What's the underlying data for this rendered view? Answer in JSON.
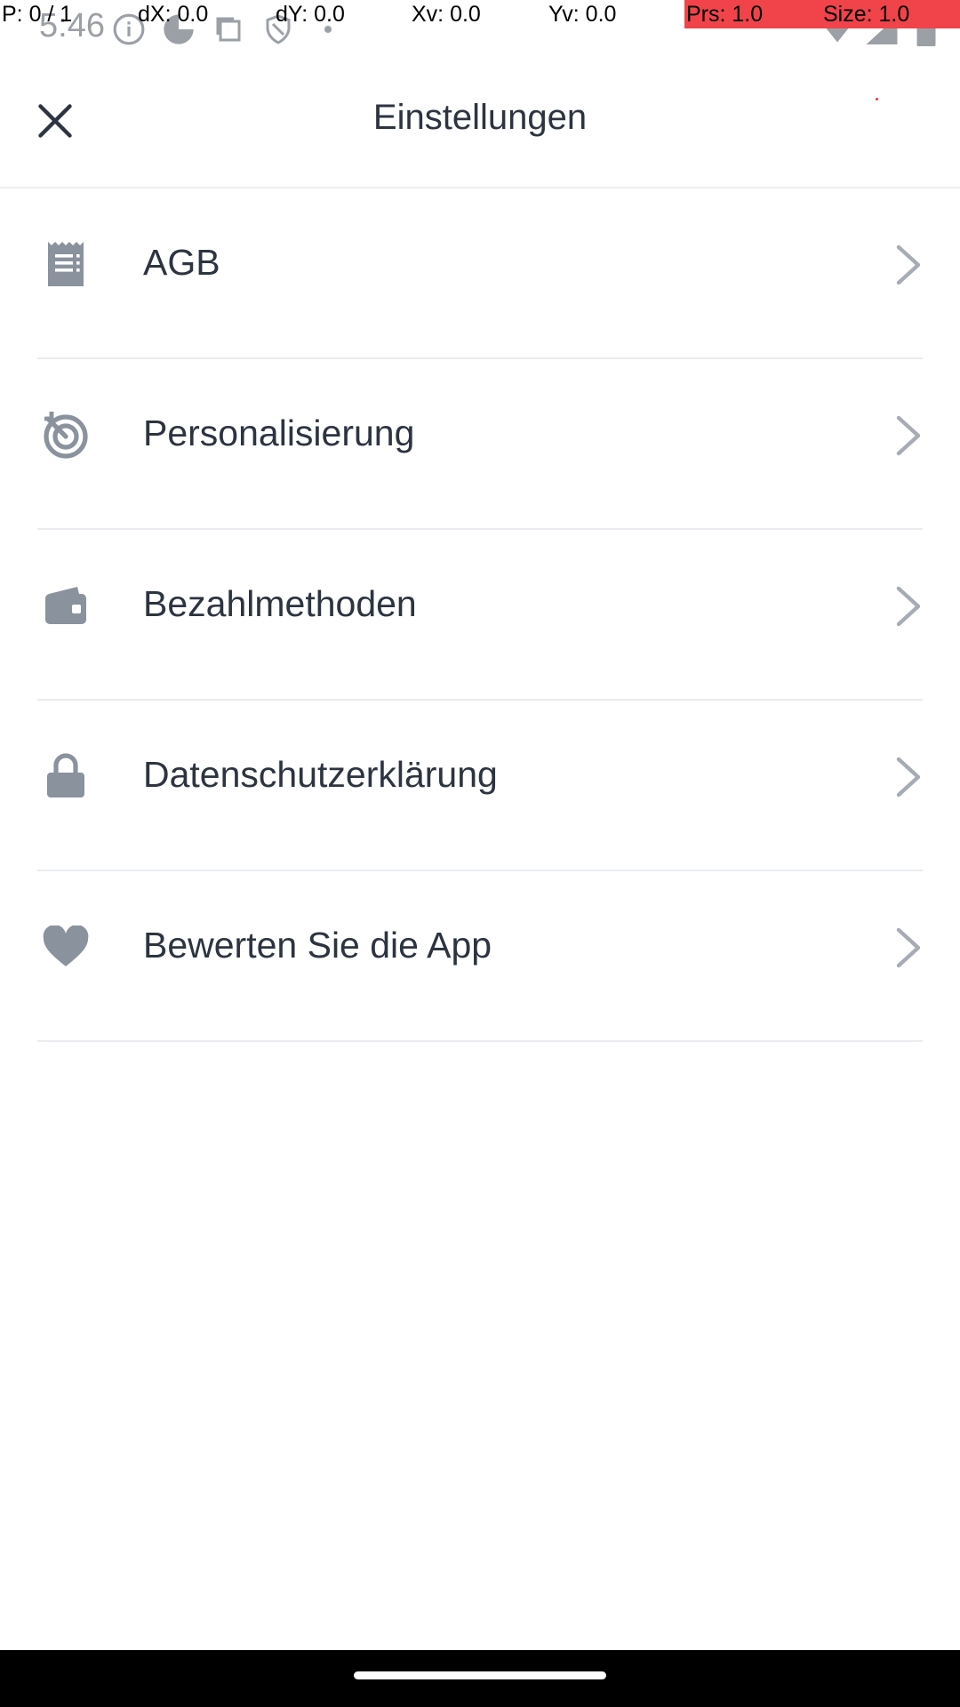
{
  "status_bar": {
    "time": "5:46"
  },
  "debug_overlay": {
    "pointer": "P: 0 / 1",
    "dx": "dX: 0.0",
    "dy": "dY: 0.0",
    "xv": "Xv: 0.0",
    "yv": "Yv: 0.0",
    "prs": "Prs: 1.0",
    "size": "Size: 1.0",
    "highlight_color": "#f0434a"
  },
  "header": {
    "title": "Einstellungen",
    "close_icon": "close-icon"
  },
  "settings": {
    "items": [
      {
        "label": "AGB",
        "icon": "document-icon"
      },
      {
        "label": "Personalisierung",
        "icon": "target-icon"
      },
      {
        "label": "Bezahlmethoden",
        "icon": "wallet-icon"
      },
      {
        "label": "Datenschutzerklärung",
        "icon": "lock-icon"
      },
      {
        "label": "Bewerten Sie die App",
        "icon": "heart-icon"
      }
    ]
  },
  "colors": {
    "icon": "#8a929e",
    "text": "#2c3440",
    "divider": "#e9ecef",
    "chevron": "#a6acb5"
  }
}
